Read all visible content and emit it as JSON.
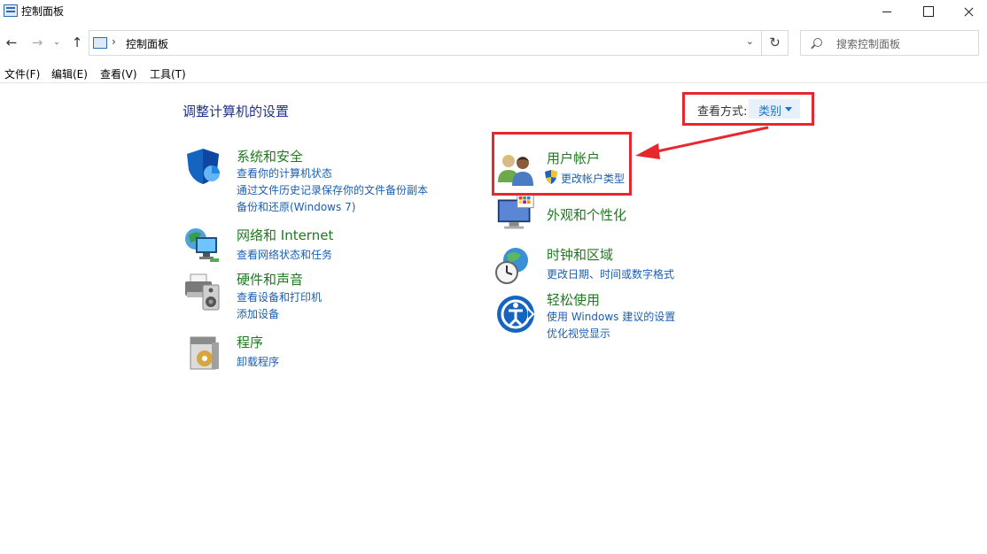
{
  "window": {
    "title": "控制面板"
  },
  "navbar": {
    "back_glyph": "←",
    "forward_glyph": "→",
    "recent_glyph": "⌄",
    "up_glyph": "↑",
    "address_separator": "›",
    "address_text": "控制面板",
    "address_dropdown_glyph": "⌄",
    "refresh_glyph": "↻",
    "search_placeholder": "搜索控制面板"
  },
  "menubar": {
    "file": "文件(F)",
    "edit": "编辑(E)",
    "view": "查看(V)",
    "tools": "工具(T)"
  },
  "main": {
    "heading": "调整计算机的设置",
    "view_by_label": "查看方式:",
    "view_by_value": "类别"
  },
  "categories_left": [
    {
      "title": "系统和安全",
      "links": [
        "查看你的计算机状态",
        "通过文件历史记录保存你的文件备份副本",
        "备份和还原(Windows 7)"
      ]
    },
    {
      "title": "网络和 Internet",
      "links": [
        "查看网络状态和任务"
      ]
    },
    {
      "title": "硬件和声音",
      "links": [
        "查看设备和打印机",
        "添加设备"
      ]
    },
    {
      "title": "程序",
      "links": [
        "卸载程序"
      ]
    }
  ],
  "categories_right": [
    {
      "title": "用户帐户",
      "links": [
        "更改帐户类型"
      ]
    },
    {
      "title": "外观和个性化",
      "links": []
    },
    {
      "title": "时钟和区域",
      "links": [
        "更改日期、时间或数字格式"
      ]
    },
    {
      "title": "轻松使用",
      "links": [
        "使用 Windows 建议的设置",
        "优化视觉显示"
      ]
    }
  ],
  "icons": {
    "system_security": "shield-icon",
    "network": "globe-network-icon",
    "hardware": "printer-speaker-icon",
    "programs": "program-box-icon",
    "user_accounts": "users-icon",
    "appearance": "monitor-palette-icon",
    "clock_region": "clock-globe-icon",
    "ease_of_access": "accessibility-icon",
    "uac_shield": "uac-shield-icon"
  },
  "colors": {
    "category_title": "#1f7a1f",
    "link": "#1a5fb4",
    "heading": "#1e3287",
    "annotation_red": "#e8262d"
  }
}
